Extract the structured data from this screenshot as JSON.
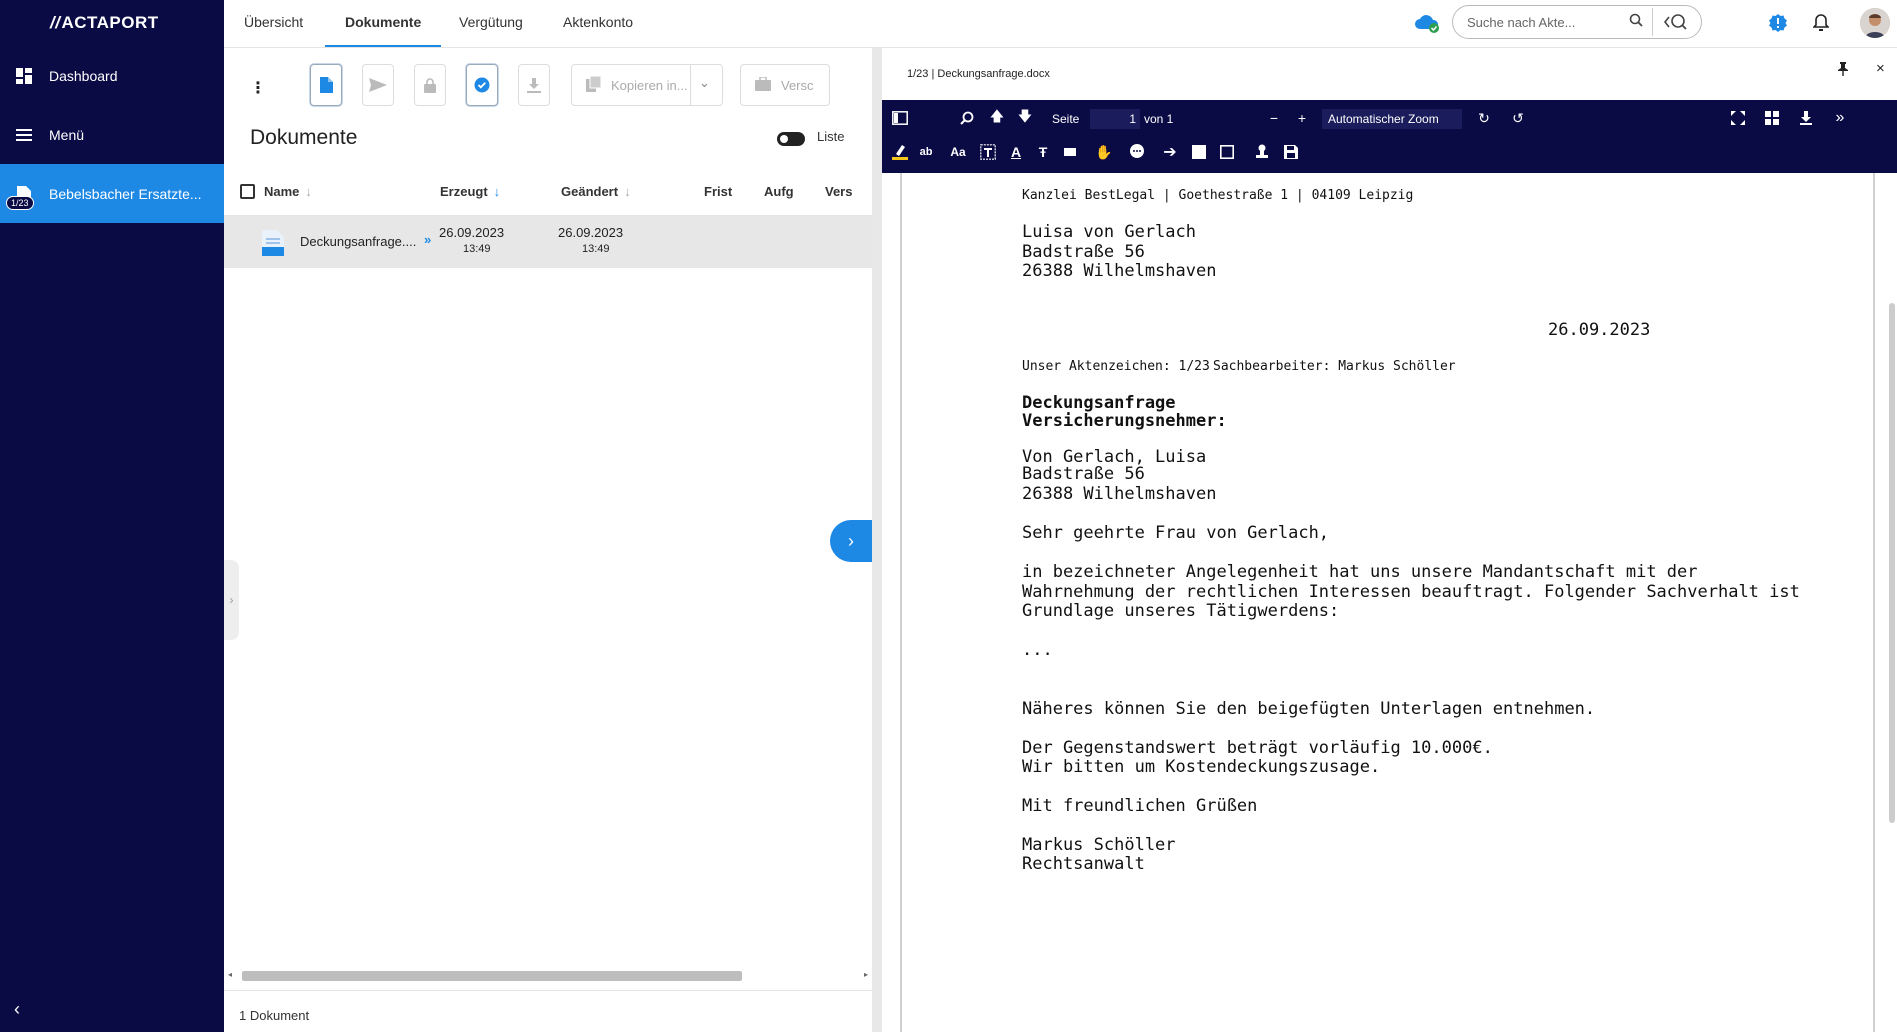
{
  "app": {
    "logo": "ACTAPORT"
  },
  "sidebar": {
    "items": [
      {
        "label": "Dashboard"
      },
      {
        "label": "Menü"
      },
      {
        "label": "Bebelsbacher Ersatzte...",
        "badge": "1/23"
      }
    ]
  },
  "topbar": {
    "tabs": [
      {
        "label": "Übersicht"
      },
      {
        "label": "Dokumente"
      },
      {
        "label": "Vergütung"
      },
      {
        "label": "Aktenkonto"
      }
    ],
    "search_placeholder": "Suche nach Akte..."
  },
  "docs": {
    "copy_label": "Kopieren in...",
    "send_label": "Versc",
    "title": "Dokumente",
    "view_toggle_label": "Liste",
    "columns": [
      "Name",
      "Erzeugt",
      "Geändert",
      "Frist",
      "Aufg",
      "Vers"
    ],
    "rows": [
      {
        "name": "Deckungsanfrage....",
        "created_date": "26.09.2023",
        "created_time": "13:49",
        "modified_date": "26.09.2023",
        "modified_time": "13:49"
      }
    ],
    "count": "1 Dokument"
  },
  "viewer": {
    "filename": "1/23 | Deckungsanfrage.docx",
    "page_label": "Seite",
    "page_current": "1",
    "page_total": "von 1",
    "zoom": "Automatischer Zoom"
  },
  "letter": {
    "sender": "Kanzlei BestLegal | Goethestraße 1 | 04109 Leipzig",
    "recipient_name": "Luisa von Gerlach",
    "recipient_street": "Badstraße 56",
    "recipient_city": "26388 Wilhelmshaven",
    "date": "26.09.2023",
    "ref": "Unser Aktenzeichen: 1/23",
    "clerk": "Sachbearbeiter: Markus Schöller",
    "subject1": "Deckungsanfrage",
    "subject2": "Versicherungsnehmer:",
    "vn_name": "Von Gerlach, Luisa",
    "vn_street": "Badstraße 56",
    "vn_city": "26388 Wilhelmshaven",
    "salutation": "Sehr geehrte Frau von Gerlach,",
    "body1": "in bezeichneter Angelegenheit hat uns unsere Mandantschaft mit der",
    "body2": "Wahrnehmung der rechtlichen Interessen beauftragt. Folgender Sachverhalt ist",
    "body3": "Grundlage unseres Tätigwerdens:",
    "ellipsis": "...",
    "body4": "Näheres können Sie den beigefügten Unterlagen entnehmen.",
    "body5": "Der Gegenstandswert beträgt vorläufig 10.000€.",
    "body6": "Wir bitten um Kostendeckungszusage.",
    "closing": "Mit freundlichen Grüßen",
    "sign_name": "Markus Schöller",
    "sign_title": "Rechtsanwalt"
  },
  "colors": {
    "sidebar_bg": "#0a0b45",
    "accent": "#1e88e5",
    "pdf_toolbar": "#0a0b45"
  }
}
